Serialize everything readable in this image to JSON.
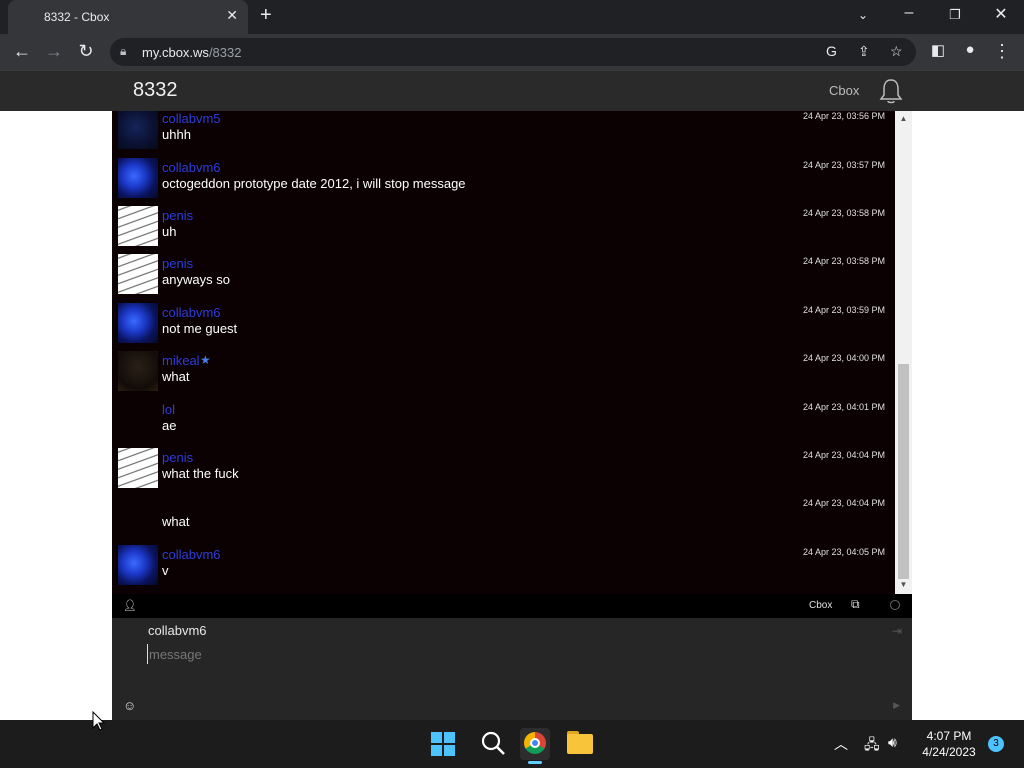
{
  "browser": {
    "tab_title": "8332 - Cbox",
    "url_host": "my.cbox.ws",
    "url_path": "/8332"
  },
  "cbox": {
    "box_name": "8332",
    "brand_link": "Cbox",
    "footer_brand": "Cbox",
    "current_user": "collabvm6",
    "message_placeholder": "message"
  },
  "messages": [
    {
      "user": "collabvm5",
      "text": "uhhh",
      "time": "24 Apr 23, 03:56 PM",
      "avatar": "dim"
    },
    {
      "user": "collabvm6",
      "text": "octogeddon prototype date 2012, i will stop message",
      "time": "24 Apr 23, 03:57 PM",
      "avatar": "jelly"
    },
    {
      "user": "penis",
      "text": "uh",
      "time": "24 Apr 23, 03:58 PM",
      "avatar": "sketch"
    },
    {
      "user": "penis",
      "text": "anyways so",
      "time": "24 Apr 23, 03:58 PM",
      "avatar": "sketch"
    },
    {
      "user": "collabvm6",
      "text": "not me guest",
      "time": "24 Apr 23, 03:59 PM",
      "avatar": "jelly"
    },
    {
      "user": "mikeal",
      "text": "what",
      "time": "24 Apr 23, 04:00 PM",
      "avatar": "dark",
      "verified": true
    },
    {
      "user": "lol",
      "text": "ae",
      "time": "24 Apr 23, 04:01 PM",
      "avatar": "none"
    },
    {
      "user": "penis",
      "text": "what the fuck",
      "time": "24 Apr 23, 04:04 PM",
      "avatar": "sketch"
    },
    {
      "user": "",
      "text": "what",
      "time": "24 Apr 23, 04:04 PM",
      "avatar": "none"
    },
    {
      "user": "collabvm6",
      "text": "v",
      "time": "24 Apr 23, 04:05 PM",
      "avatar": "jelly"
    }
  ],
  "taskbar": {
    "time": "4:07 PM",
    "date": "4/24/2023",
    "notification_count": "3"
  },
  "colors": {
    "chat_bg": "#0b0102",
    "username": "#2d3ddb",
    "accent": "#4cc2ff"
  }
}
